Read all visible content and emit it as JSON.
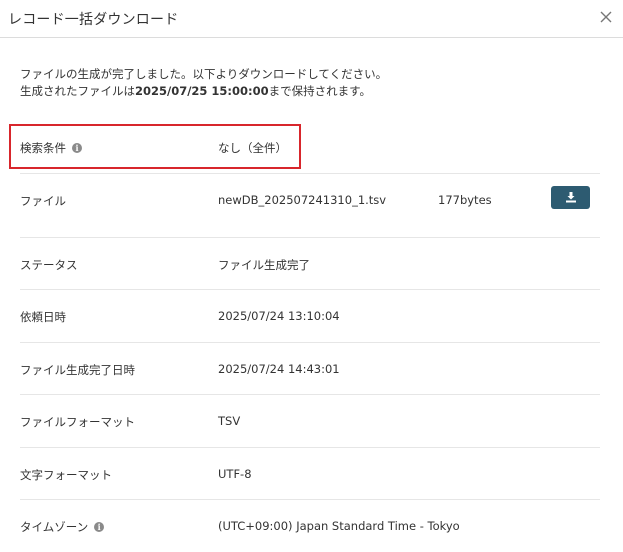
{
  "dialog": {
    "title": "レコード一括ダウンロード"
  },
  "message": {
    "line1": "ファイルの生成が完了しました。以下よりダウンロードしてください。",
    "line2_prefix": "生成されたファイルは",
    "line2_date": "2025/07/25 15:00:00",
    "line2_suffix": "まで保持されます。"
  },
  "rows": {
    "search_label": "検索条件",
    "search_value": "なし（全件）",
    "file_label": "ファイル",
    "file_name": "newDB_202507241310_1.tsv",
    "file_size": "177bytes",
    "status_label": "ステータス",
    "status_value": "ファイル生成完了",
    "request_label": "依頼日時",
    "request_value": "2025/07/24 13:10:04",
    "generated_label": "ファイル生成完了日時",
    "generated_value": "2025/07/24 14:43:01",
    "format_label": "ファイルフォーマット",
    "format_value": "TSV",
    "charset_label": "文字フォーマット",
    "charset_value": "UTF-8",
    "timezone_label": "タイムゾーン",
    "timezone_value": "(UTC+09:00) Japan Standard Time - Tokyo"
  },
  "icons": {
    "info": "i",
    "download": "download-icon",
    "close": "close-icon"
  },
  "colors": {
    "highlight_border": "#d8262c",
    "download_button": "#2d5b71"
  }
}
